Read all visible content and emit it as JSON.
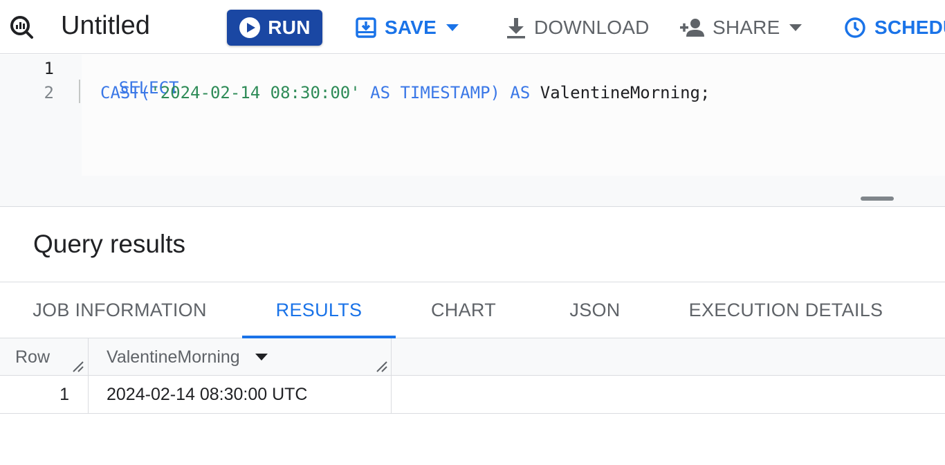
{
  "toolbar": {
    "title": "Untitled",
    "run_label": "RUN",
    "save_label": "SAVE",
    "download_label": "DOWNLOAD",
    "share_label": "SHARE",
    "schedule_label": "SCHEDU"
  },
  "editor": {
    "line_numbers": [
      "1",
      "2"
    ],
    "line1": {
      "keyword": "SELECT"
    },
    "line2": {
      "func": "CAST(",
      "string": "'2024-02-14 08:30:00'",
      "as1": " AS ",
      "type": "TIMESTAMP)",
      "as2": " AS ",
      "alias": "ValentineMorning;"
    }
  },
  "results": {
    "title": "Query results",
    "tabs": [
      "JOB INFORMATION",
      "RESULTS",
      "CHART",
      "JSON",
      "EXECUTION DETAILS"
    ],
    "active_tab": "RESULTS",
    "columns": [
      "Row",
      "ValentineMorning"
    ],
    "rows": [
      [
        "1",
        "2024-02-14 08:30:00 UTC"
      ]
    ]
  },
  "colors": {
    "primary": "#1a73e8",
    "run_button": "#1a47a3",
    "keyword": "#3b78e7",
    "string": "#2e8b57"
  },
  "icons": [
    "query-icon",
    "play-icon",
    "save-icon",
    "download-icon",
    "person-add-icon",
    "schedule-clock-icon",
    "caret-down-icon",
    "column-resize-icon"
  ]
}
